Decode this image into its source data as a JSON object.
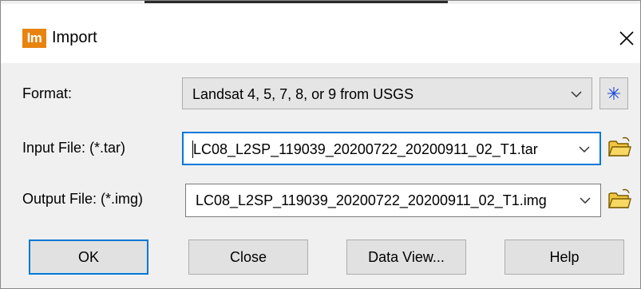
{
  "window": {
    "title": "Import",
    "app_icon_text": "lm"
  },
  "form": {
    "format_label": "Format:",
    "format_value": "Landsat 4, 5, 7, 8, or 9 from USGS",
    "format_extra_icon": "asterisk-icon",
    "input_label": "Input File: (*.tar)",
    "input_value": "LC08_L2SP_119039_20200722_20200911_02_T1.tar",
    "output_label": "Output File: (*.img)",
    "output_value": "LC08_L2SP_119039_20200722_20200911_02_T1.img"
  },
  "buttons": {
    "ok": "OK",
    "close": "Close",
    "data_view": "Data View...",
    "help": "Help"
  },
  "colors": {
    "accent": "#0078d7",
    "app_icon": "#e8830f",
    "folder": "#f2c641",
    "asterisk": "#1a45d6"
  }
}
